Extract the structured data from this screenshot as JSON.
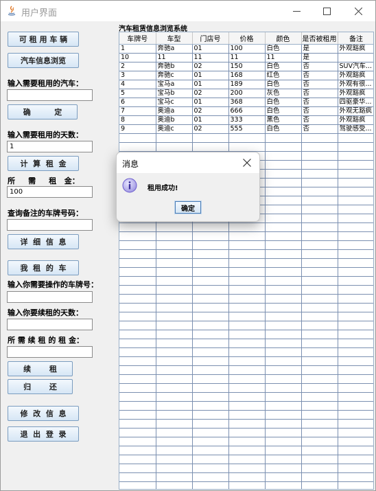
{
  "window": {
    "title": "用户界面"
  },
  "left": {
    "available_cars_button": "可 租 用 车 辆",
    "car_info_button": "汽车信息浏览",
    "rent_car_label": "输入需要租用的汽车：",
    "rent_car_value": "",
    "confirm_button": "确         定",
    "rent_days_label": "输入需要租用的天数：",
    "rent_days_value": "1",
    "calc_rent_button": "计  算  租  金",
    "required_rent_label": "所     需     租   金：",
    "required_rent_value": "100",
    "query_plate_label": "查询备注的车牌号码：",
    "query_plate_value": "",
    "detail_button": "详  细  信  息",
    "my_cars_button": "我  租  的  车",
    "operate_plate_label": "输入你需要操作的车牌号：",
    "operate_plate_value": "",
    "renew_days_label": "输入你要续租的天数：",
    "renew_days_value": "",
    "renew_rent_label": "所 需 续 租 的 租 金：",
    "renew_rent_value": "",
    "renew_button": "续       租",
    "return_button": "归       还",
    "modify_button": "修  改  信  息",
    "logout_button": "退  出  登  录"
  },
  "table": {
    "title": "汽车租赁信息浏览系统",
    "columns": [
      "车牌号",
      "车型",
      "门店号",
      "价格",
      "颜色",
      "是否被租用",
      "备注"
    ],
    "rows": [
      [
        "1",
        "奔驰a",
        "01",
        "100",
        "白色",
        "是",
        "外观豁疯"
      ],
      [
        "10",
        "11",
        "11",
        "11",
        "11",
        "是",
        ""
      ],
      [
        "2",
        "奔驰b",
        "02",
        "150",
        "白色",
        "否",
        "SUV汽车..."
      ],
      [
        "3",
        "奔驰c",
        "01",
        "168",
        "红色",
        "否",
        "外观豁疯"
      ],
      [
        "4",
        "宝马a",
        "01",
        "189",
        "白色",
        "否",
        "外观有很..."
      ],
      [
        "5",
        "宝马b",
        "02",
        "200",
        "灰色",
        "否",
        "外观豁疯"
      ],
      [
        "6",
        "宝马c",
        "01",
        "368",
        "白色",
        "否",
        "四驱豪华..."
      ],
      [
        "7",
        "奥迪a",
        "02",
        "666",
        "白色",
        "否",
        "外观无豁疯"
      ],
      [
        "8",
        "奥迪b",
        "01",
        "333",
        "黑色",
        "否",
        "外观豁疯"
      ],
      [
        "9",
        "奥迪c",
        "02",
        "555",
        "白色",
        "否",
        "驾驶感受..."
      ]
    ]
  },
  "dialog": {
    "title": "消息",
    "message": "租用成功!",
    "ok_button": "确定"
  },
  "colors": {
    "button_gradient_top": "#f3f8fd",
    "button_gradient_bottom": "#d6e6f5",
    "button_border": "#7a9cbf",
    "info_icon": "#6a5acd"
  }
}
